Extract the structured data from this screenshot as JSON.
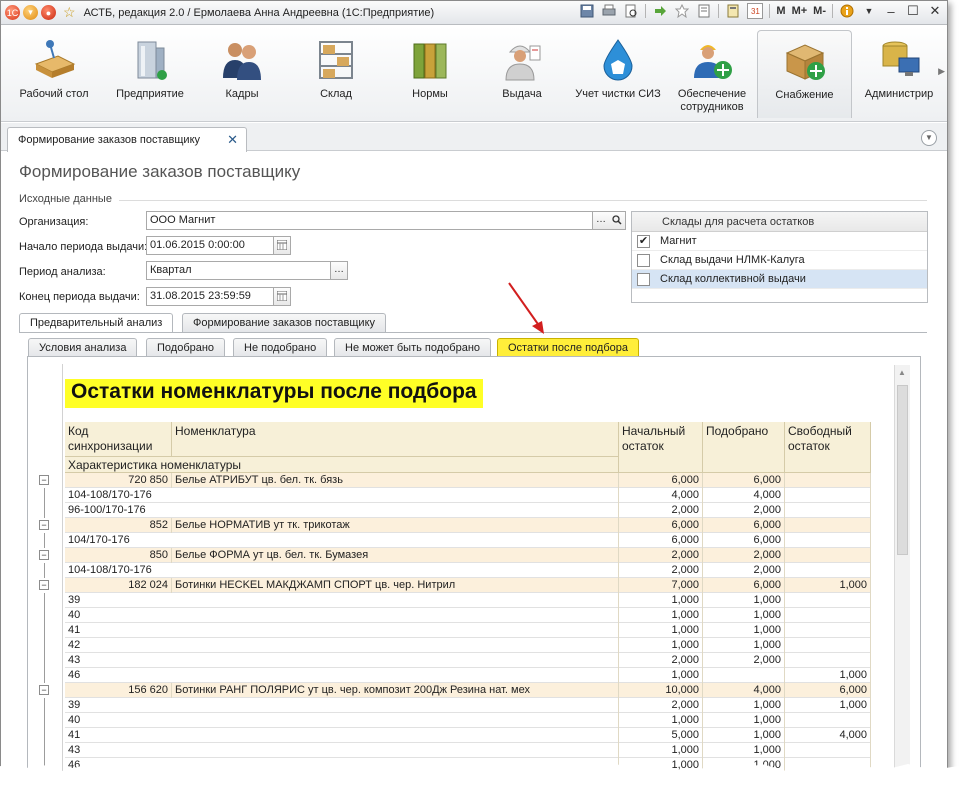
{
  "window": {
    "title": "АСТБ, редакция 2.0 / Ермолаева Анна Андреевна  (1С:Предприятие)",
    "toolbar_m": [
      "M",
      "M+",
      "M-"
    ],
    "calendar_day": "31"
  },
  "sections": [
    {
      "label": "Рабочий стол",
      "icon": "desk-icon"
    },
    {
      "label": "Предприятие",
      "icon": "building-icon"
    },
    {
      "label": "Кадры",
      "icon": "people-icon"
    },
    {
      "label": "Склад",
      "icon": "warehouse-shelf-icon"
    },
    {
      "label": "Нормы",
      "icon": "binders-icon"
    },
    {
      "label": "Выдача",
      "icon": "worker-icon"
    },
    {
      "label": "Учет чистки СИЗ",
      "icon": "water-drop-icon"
    },
    {
      "label": "Обеспечение сотрудников",
      "icon": "user-add-icon"
    },
    {
      "label": "Снабжение",
      "icon": "box-add-icon"
    },
    {
      "label": "Администрир",
      "icon": "database-pc-icon"
    }
  ],
  "doc_tab": {
    "label": "Формирование заказов поставщику",
    "close": "✕"
  },
  "form": {
    "title": "Формирование заказов поставщику",
    "group": "Исходные данные",
    "org_label": "Организация:",
    "org_value": "ООО Магнит",
    "start_label": "Начало периода выдачи:",
    "start_value": "01.06.2015  0:00:00",
    "period_label": "Период анализа:",
    "period_value": "Квартал",
    "end_label": "Конец периода выдачи:",
    "end_value": "31.08.2015 23:59:59"
  },
  "warehouses": {
    "header": "Склады для расчета остатков",
    "items": [
      {
        "label": "Магнит",
        "checked": "✔"
      },
      {
        "label": "Склад выдачи НЛМК-Калуга",
        "checked": ""
      },
      {
        "label": "Склад коллективной выдачи",
        "checked": ""
      }
    ]
  },
  "tabs1": [
    "Предварительный анализ",
    "Формирование заказов поставщику"
  ],
  "tabs2": [
    "Условия анализа",
    "Подобрано",
    "Не подобрано",
    "Не может быть подобрано",
    "Остатки после подбора"
  ],
  "report": {
    "title": "Остатки номенклатуры после подбора",
    "headers": {
      "code": "Код синхронизации",
      "nomenclature": "Номенклатура",
      "characteristic": "Характеристика номенклатуры",
      "initial": "Начальный остаток",
      "picked": "Подобрано",
      "free": "Свободный остаток"
    },
    "rows": [
      {
        "group": true,
        "code": "720 850",
        "name": "Белье АТРИБУТ цв. бел. тк. бязь",
        "initial": "6,000",
        "picked": "6,000",
        "free": ""
      },
      {
        "group": false,
        "name": "104-108/170-176",
        "initial": "4,000",
        "picked": "4,000",
        "free": ""
      },
      {
        "group": false,
        "name": "96-100/170-176",
        "initial": "2,000",
        "picked": "2,000",
        "free": ""
      },
      {
        "group": true,
        "code": "852",
        "name": "Белье НОРМАТИВ ут тк. трикотаж",
        "initial": "6,000",
        "picked": "6,000",
        "free": ""
      },
      {
        "group": false,
        "name": "104/170-176",
        "initial": "6,000",
        "picked": "6,000",
        "free": ""
      },
      {
        "group": true,
        "code": "850",
        "name": "Белье ФОРМА ут цв. бел. тк. Бумазея",
        "initial": "2,000",
        "picked": "2,000",
        "free": ""
      },
      {
        "group": false,
        "name": "104-108/170-176",
        "initial": "2,000",
        "picked": "2,000",
        "free": ""
      },
      {
        "group": true,
        "code": "182 024",
        "name": "Ботинки HECKEL МАКДЖАМП СПОРТ цв. чер. Нитрил",
        "initial": "7,000",
        "picked": "6,000",
        "free": "1,000"
      },
      {
        "group": false,
        "name": "39",
        "initial": "1,000",
        "picked": "1,000",
        "free": ""
      },
      {
        "group": false,
        "name": "40",
        "initial": "1,000",
        "picked": "1,000",
        "free": ""
      },
      {
        "group": false,
        "name": "41",
        "initial": "1,000",
        "picked": "1,000",
        "free": ""
      },
      {
        "group": false,
        "name": "42",
        "initial": "1,000",
        "picked": "1,000",
        "free": ""
      },
      {
        "group": false,
        "name": "43",
        "initial": "2,000",
        "picked": "2,000",
        "free": ""
      },
      {
        "group": false,
        "name": "46",
        "initial": "1,000",
        "picked": "",
        "free": "1,000"
      },
      {
        "group": true,
        "code": "156 620",
        "name": "Ботинки РАНГ ПОЛЯРИС ут цв. чер. композит 200Дж Резина нат. мех",
        "initial": "10,000",
        "picked": "4,000",
        "free": "6,000"
      },
      {
        "group": false,
        "name": "39",
        "initial": "2,000",
        "picked": "1,000",
        "free": "1,000"
      },
      {
        "group": false,
        "name": "40",
        "initial": "1,000",
        "picked": "1,000",
        "free": ""
      },
      {
        "group": false,
        "name": "41",
        "initial": "5,000",
        "picked": "1,000",
        "free": "4,000"
      },
      {
        "group": false,
        "name": "43",
        "initial": "1,000",
        "picked": "1,000",
        "free": ""
      },
      {
        "group": false,
        "name": "46",
        "initial": "1,000",
        "picked": "1,000",
        "free": ""
      }
    ]
  },
  "colors": {
    "accent_tab": "#ffee3a",
    "report_title_bg": "#ffff26",
    "group_row": "#fcf0dc",
    "header_bg": "#f7f0d8",
    "arrow": "#d21f1f"
  }
}
